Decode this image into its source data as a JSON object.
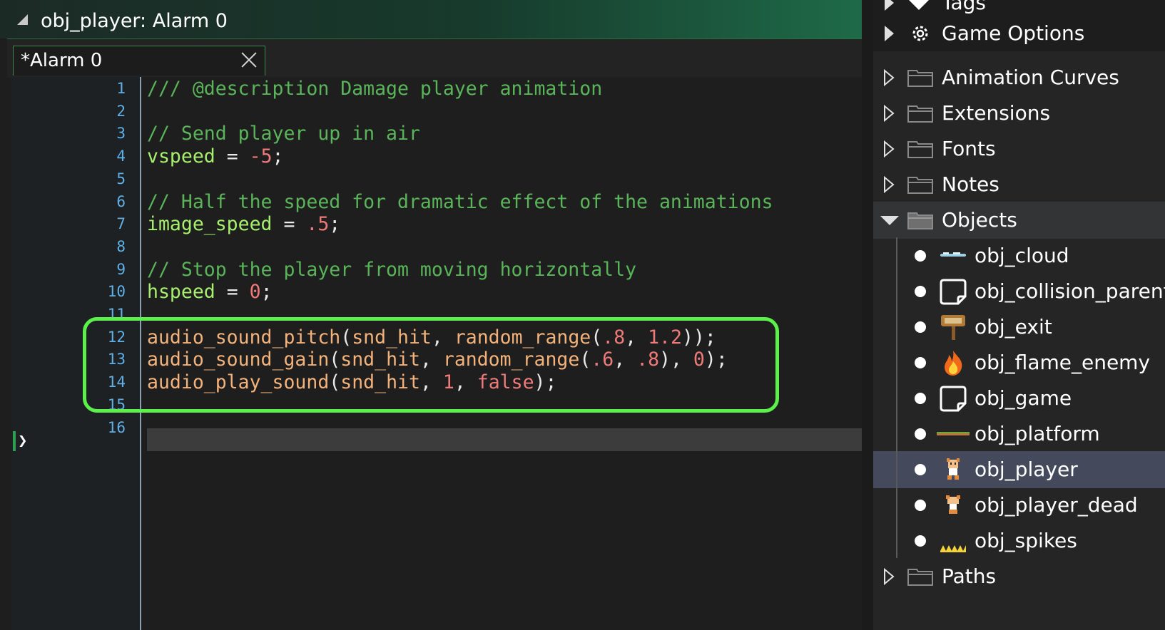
{
  "window": {
    "title": "obj_player: Alarm 0",
    "tab_label": "*Alarm 0"
  },
  "colors": {
    "highlight_box": "#5bf04a",
    "comment": "#5ab55a",
    "variable": "#a6f06e",
    "number": "#ef7a7a",
    "function": "#f3b27a",
    "line_number": "#5fb0e6",
    "selection": "#444a5c"
  },
  "code": {
    "line_numbers": [
      "1",
      "2",
      "3",
      "4",
      "5",
      "6",
      "7",
      "8",
      "9",
      "10",
      "11",
      "12",
      "13",
      "14",
      "15",
      "16"
    ],
    "lines": [
      [
        {
          "t": "/// @description Damage player animation",
          "c": "comment"
        }
      ],
      [],
      [
        {
          "t": "// Send player up in air",
          "c": "comment"
        }
      ],
      [
        {
          "t": "vspeed",
          "c": "var"
        },
        {
          "t": " = ",
          "c": "op"
        },
        {
          "t": "-5",
          "c": "num"
        },
        {
          "t": ";",
          "c": "op"
        }
      ],
      [],
      [
        {
          "t": "// Half the speed for dramatic effect of the animations",
          "c": "comment"
        }
      ],
      [
        {
          "t": "image_speed",
          "c": "var"
        },
        {
          "t": " = ",
          "c": "op"
        },
        {
          "t": ".5",
          "c": "num"
        },
        {
          "t": ";",
          "c": "op"
        }
      ],
      [],
      [
        {
          "t": "// Stop the player from moving horizontally",
          "c": "comment"
        }
      ],
      [
        {
          "t": "hspeed",
          "c": "var"
        },
        {
          "t": " = ",
          "c": "op"
        },
        {
          "t": "0",
          "c": "num"
        },
        {
          "t": ";",
          "c": "op"
        }
      ],
      [],
      [
        {
          "t": "audio_sound_pitch",
          "c": "func"
        },
        {
          "t": "(",
          "c": "op"
        },
        {
          "t": "snd_hit",
          "c": "res"
        },
        {
          "t": ", ",
          "c": "op"
        },
        {
          "t": "random_range",
          "c": "func"
        },
        {
          "t": "(",
          "c": "op"
        },
        {
          "t": ".8",
          "c": "num"
        },
        {
          "t": ", ",
          "c": "op"
        },
        {
          "t": "1.2",
          "c": "num"
        },
        {
          "t": "));",
          "c": "op"
        }
      ],
      [
        {
          "t": "audio_sound_gain",
          "c": "func"
        },
        {
          "t": "(",
          "c": "op"
        },
        {
          "t": "snd_hit",
          "c": "res"
        },
        {
          "t": ", ",
          "c": "op"
        },
        {
          "t": "random_range",
          "c": "func"
        },
        {
          "t": "(",
          "c": "op"
        },
        {
          "t": ".6",
          "c": "num"
        },
        {
          "t": ", ",
          "c": "op"
        },
        {
          "t": ".8",
          "c": "num"
        },
        {
          "t": "), ",
          "c": "op"
        },
        {
          "t": "0",
          "c": "num"
        },
        {
          "t": ");",
          "c": "op"
        }
      ],
      [
        {
          "t": "audio_play_sound",
          "c": "func"
        },
        {
          "t": "(",
          "c": "op"
        },
        {
          "t": "snd_hit",
          "c": "res"
        },
        {
          "t": ", ",
          "c": "op"
        },
        {
          "t": "1",
          "c": "num"
        },
        {
          "t": ", ",
          "c": "op"
        },
        {
          "t": "false",
          "c": "kw"
        },
        {
          "t": ");",
          "c": "op"
        }
      ],
      [],
      []
    ]
  },
  "asset_tree": {
    "top_items": [
      {
        "label": "Tags",
        "icon": "tag-icon"
      },
      {
        "label": "Game Options",
        "icon": "gear-icon"
      }
    ],
    "folders_before": [
      {
        "label": "Animation Curves"
      },
      {
        "label": "Extensions"
      },
      {
        "label": "Fonts"
      },
      {
        "label": "Notes"
      }
    ],
    "objects_folder": {
      "label": "Objects"
    },
    "objects": [
      {
        "label": "obj_cloud",
        "icon": "cloud-sprite-icon"
      },
      {
        "label": "obj_collision_parent",
        "icon": "empty-sprite-icon"
      },
      {
        "label": "obj_exit",
        "icon": "exit-sign-icon"
      },
      {
        "label": "obj_flame_enemy",
        "icon": "flame-icon"
      },
      {
        "label": "obj_game",
        "icon": "empty-sprite-icon"
      },
      {
        "label": "obj_platform",
        "icon": "platform-sprite-icon"
      },
      {
        "label": "obj_player",
        "icon": "player-sprite-icon",
        "selected": true
      },
      {
        "label": "obj_player_dead",
        "icon": "player-dead-sprite-icon"
      },
      {
        "label": "obj_spikes",
        "icon": "spikes-icon"
      }
    ],
    "folders_after": [
      {
        "label": "Paths"
      }
    ]
  }
}
